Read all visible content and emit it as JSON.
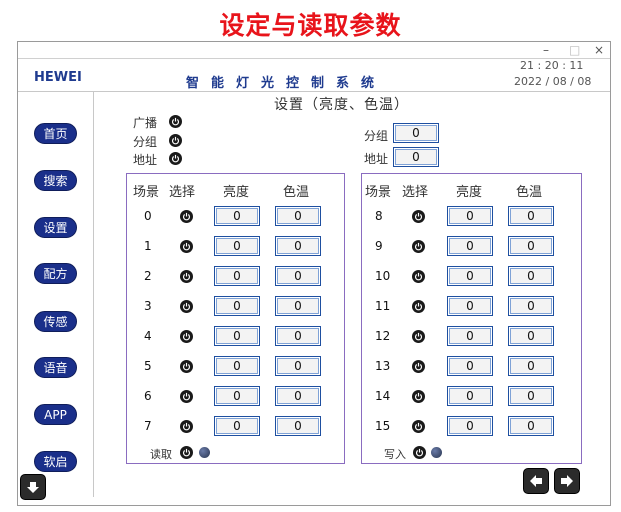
{
  "page_title": "设定与读取参数",
  "window": {
    "controls": [
      "–",
      "□",
      "×"
    ],
    "brand": "HEWEI",
    "system_title": "智能灯光控制系统",
    "clock_time": "21 : 20 : 11",
    "clock_date": "2022 / 08 / 08"
  },
  "nav": [
    "首页",
    "搜索",
    "设置",
    "配方",
    "传感",
    "语音",
    "APP",
    "软启"
  ],
  "panel_title": "设置（亮度、色温）",
  "mode": {
    "broadcast": "广播",
    "group": "分组",
    "address": "地址"
  },
  "target": {
    "group_label": "分组",
    "group_value": "0",
    "address_label": "地址",
    "address_value": "0"
  },
  "table_headers": {
    "scene": "场景",
    "select": "选择",
    "brightness": "亮度",
    "color_temp": "色温"
  },
  "left_scenes": [
    {
      "scene": "0",
      "brightness": "0",
      "color_temp": "0"
    },
    {
      "scene": "1",
      "brightness": "0",
      "color_temp": "0"
    },
    {
      "scene": "2",
      "brightness": "0",
      "color_temp": "0"
    },
    {
      "scene": "3",
      "brightness": "0",
      "color_temp": "0"
    },
    {
      "scene": "4",
      "brightness": "0",
      "color_temp": "0"
    },
    {
      "scene": "5",
      "brightness": "0",
      "color_temp": "0"
    },
    {
      "scene": "6",
      "brightness": "0",
      "color_temp": "0"
    },
    {
      "scene": "7",
      "brightness": "0",
      "color_temp": "0"
    }
  ],
  "right_scenes": [
    {
      "scene": "8",
      "brightness": "0",
      "color_temp": "0"
    },
    {
      "scene": "9",
      "brightness": "0",
      "color_temp": "0"
    },
    {
      "scene": "10",
      "brightness": "0",
      "color_temp": "0"
    },
    {
      "scene": "11",
      "brightness": "0",
      "color_temp": "0"
    },
    {
      "scene": "12",
      "brightness": "0",
      "color_temp": "0"
    },
    {
      "scene": "13",
      "brightness": "0",
      "color_temp": "0"
    },
    {
      "scene": "14",
      "brightness": "0",
      "color_temp": "0"
    },
    {
      "scene": "15",
      "brightness": "0",
      "color_temp": "0"
    }
  ],
  "read_label": "读取",
  "write_label": "写入",
  "colors": {
    "title_red": "#e8141b",
    "brand_blue": "#1f3b8f",
    "nav_blue": "#1a2f8a",
    "group_border": "#8a6cc0",
    "box_border": "#1e4fa0"
  }
}
